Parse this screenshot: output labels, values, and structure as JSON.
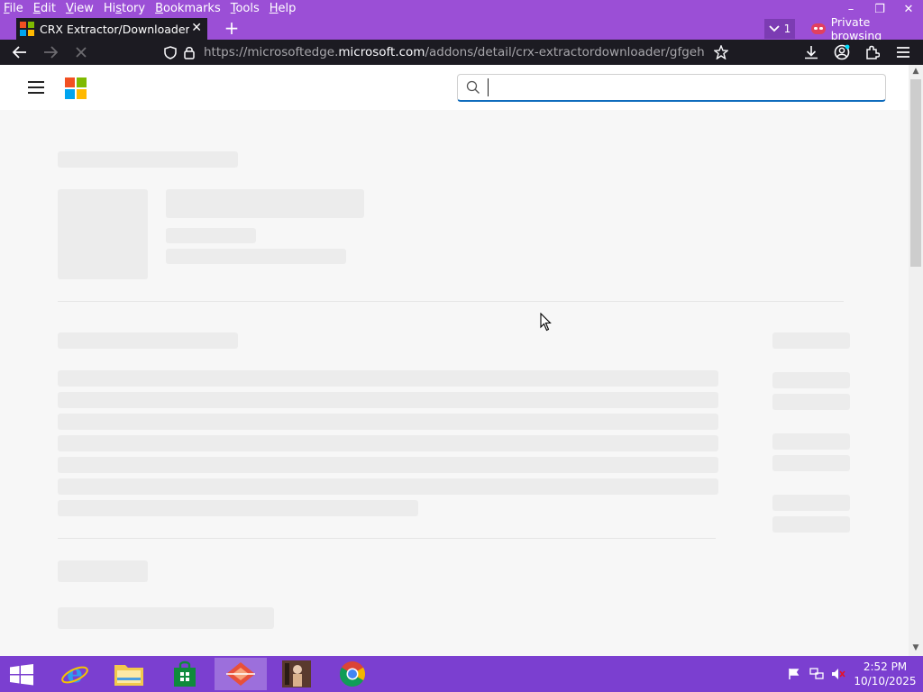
{
  "menubar": {
    "items": [
      "File",
      "Edit",
      "View",
      "History",
      "Bookmarks",
      "Tools",
      "Help"
    ],
    "underline": [
      "F",
      "E",
      "V",
      "s",
      "B",
      "T",
      "H"
    ]
  },
  "window_controls": {
    "minimize": "–",
    "restore": "❐",
    "close": "✕"
  },
  "tab": {
    "title": "CRX Extractor/Downloader - Mi",
    "close": "✕"
  },
  "new_tab": "+",
  "tab_list": {
    "count": "1"
  },
  "private_label": "Private browsing",
  "url": {
    "prefix": "https://microsoftedge.",
    "host": "microsoft.com",
    "path": "/addons/detail/crx-extractordownloader/gfgehnhkagge"
  },
  "search": {
    "value": "",
    "placeholder": ""
  },
  "clock": {
    "time": "2:52 PM",
    "date": "10/10/2025"
  },
  "colors": {
    "accent": "#9b4fd6",
    "toolbar": "#1c1b22",
    "taskbar": "#7b3fd0",
    "search_focus": "#0f6cbd"
  }
}
